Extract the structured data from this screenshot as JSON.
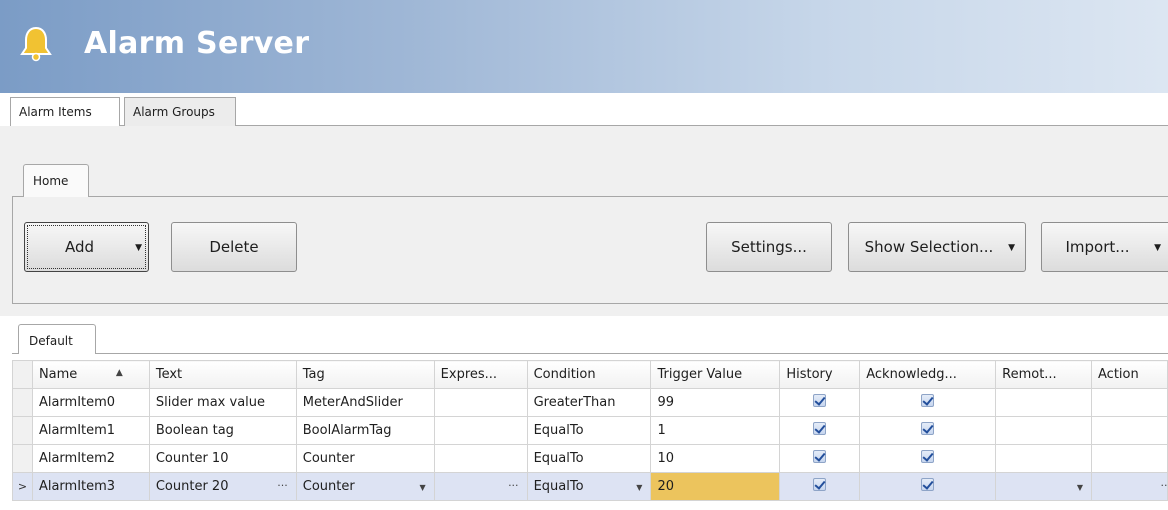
{
  "header": {
    "title": "Alarm Server",
    "icon": "bell-icon",
    "bell_color": "#f1c232"
  },
  "main_tabs": [
    "Alarm Items",
    "Alarm Groups"
  ],
  "ribbon": {
    "tab": "Home",
    "buttons": {
      "add": "Add",
      "delete": "Delete",
      "settings": "Settings...",
      "show_selection": "Show Selection...",
      "import": "Import..."
    }
  },
  "view_tab": "Default",
  "grid": {
    "columns": [
      "Name",
      "Text",
      "Tag",
      "Expres...",
      "Condition",
      "Trigger Value",
      "History",
      "Acknowledg...",
      "Remot...",
      "Action"
    ],
    "sort_column": "Name",
    "sort_direction": "ascending",
    "rows": [
      {
        "name": "AlarmItem0",
        "text": "Slider max value",
        "tag": "MeterAndSlider",
        "expression": "",
        "condition": "GreaterThan",
        "trigger": "99",
        "history": true,
        "acknowledge": true,
        "remote": "",
        "action": ""
      },
      {
        "name": "AlarmItem1",
        "text": "Boolean tag",
        "tag": "BoolAlarmTag",
        "expression": "",
        "condition": "EqualTo",
        "trigger": "1",
        "history": true,
        "acknowledge": true,
        "remote": "",
        "action": ""
      },
      {
        "name": "AlarmItem2",
        "text": "Counter 10",
        "tag": "Counter",
        "expression": "",
        "condition": "EqualTo",
        "trigger": "10",
        "history": true,
        "acknowledge": true,
        "remote": "",
        "action": ""
      },
      {
        "name": "AlarmItem3",
        "text": "Counter 20",
        "tag": "Counter",
        "expression": "",
        "condition": "EqualTo",
        "trigger": "20",
        "history": true,
        "acknowledge": true,
        "remote": "",
        "action": ""
      }
    ],
    "selected_row": 3,
    "ellipsis": "···",
    "current_row_marker": ">",
    "colors": {
      "selected_row": "#dde3f3",
      "active_cell": "#ecc45d"
    }
  }
}
